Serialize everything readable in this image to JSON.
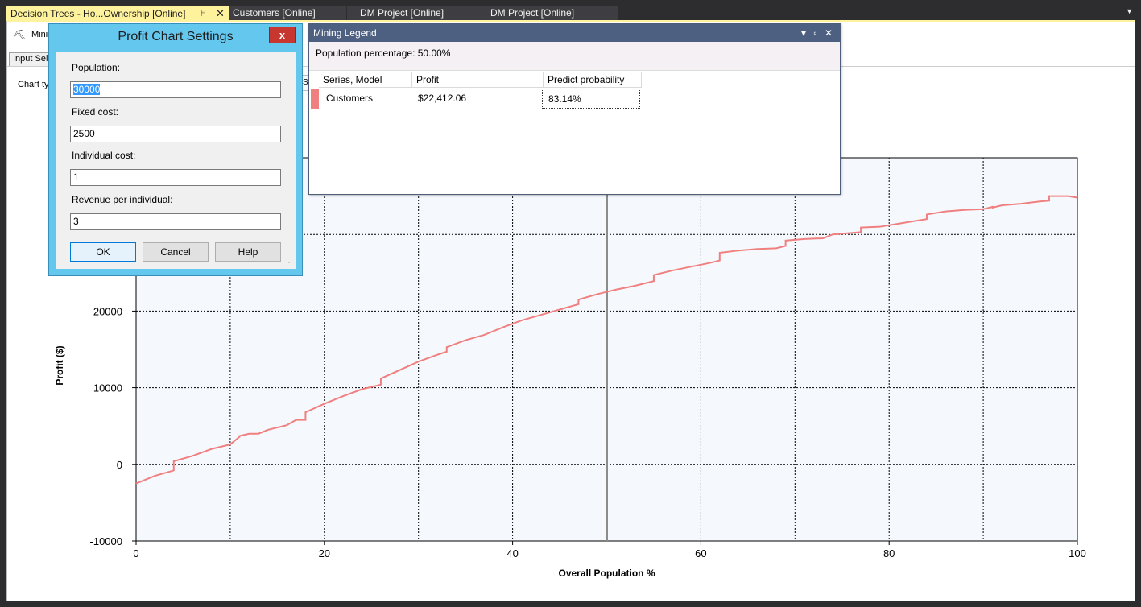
{
  "tabs": [
    {
      "label": "Decision Trees - Ho...Ownership [Online]",
      "active": true
    },
    {
      "label": "Customers [Online]",
      "active": false
    },
    {
      "label": "DM Project [Online]",
      "active": false
    },
    {
      "label": "DM Project [Online]",
      "active": false
    }
  ],
  "tab_pin_glyph": "⊧",
  "tab_close_glyph": "✕",
  "tab_overflow_glyph": "▼",
  "toolbar": {
    "label": "Mini",
    "icon": "pickaxe-icon"
  },
  "subtab_label": "Input Sel",
  "chart_type_label": "Chart ty",
  "chart_type_combo_text": "S",
  "dialog": {
    "title": "Profit Chart Settings",
    "close_glyph": "x",
    "fields": [
      {
        "label": "Population:",
        "value": "30000"
      },
      {
        "label": "Fixed cost:",
        "value": "2500"
      },
      {
        "label": "Individual cost:",
        "value": "1"
      },
      {
        "label": "Revenue per individual:",
        "value": "3"
      }
    ],
    "buttons": {
      "ok": "OK",
      "cancel": "Cancel",
      "help": "Help"
    }
  },
  "legend": {
    "title": "Mining Legend",
    "window_buttons": "▾ ▫ ✕",
    "population_text": "Population percentage: 50.00%",
    "columns": [
      "Series, Model",
      "Profit",
      "Predict probability"
    ],
    "rows": [
      {
        "series": "Customers",
        "profit": "$22,412.06",
        "probability": "83.14%",
        "color": "#f08080"
      }
    ]
  },
  "chart_data": {
    "type": "line",
    "xlabel": "Overall Population %",
    "ylabel": "Profit ($)",
    "xlim": [
      0,
      100
    ],
    "ylim": [
      -10000,
      40000
    ],
    "x_ticks": [
      "0",
      "20",
      "40",
      "60",
      "80",
      "100"
    ],
    "y_ticks": [
      "-10000",
      "0",
      "10000",
      "20000"
    ],
    "series": [
      {
        "color": "#f08080",
        "x": [
          0,
          2,
          4,
          4,
          6,
          8,
          10,
          11,
          11,
          12,
          13,
          14,
          16,
          17,
          18,
          18,
          20,
          22,
          24,
          26,
          26,
          28,
          30,
          32,
          33,
          33,
          35,
          37,
          39,
          41,
          43,
          45,
          47,
          47,
          49,
          51,
          53,
          55,
          55,
          57,
          59,
          61,
          62,
          62,
          64,
          66,
          68,
          69,
          69,
          71,
          73,
          74,
          77,
          77,
          79,
          81,
          84,
          84,
          86,
          88,
          90,
          91,
          91,
          92,
          94,
          96,
          97,
          97,
          99,
          100
        ],
        "y": [
          -2500,
          -1500,
          -800,
          400,
          1100,
          2000,
          2600,
          3600,
          3700,
          4000,
          4000,
          4500,
          5100,
          5800,
          5800,
          6800,
          7900,
          8900,
          9800,
          10400,
          11200,
          12300,
          13400,
          14300,
          14700,
          15300,
          16200,
          16900,
          17900,
          18800,
          19500,
          20200,
          20900,
          21500,
          22200,
          22800,
          23300,
          23900,
          24700,
          25300,
          25800,
          26300,
          26600,
          27600,
          27900,
          28100,
          28200,
          28500,
          29200,
          29400,
          29500,
          30000,
          30300,
          30900,
          31000,
          31400,
          32000,
          32600,
          33000,
          33200,
          33300,
          33600,
          33500,
          33800,
          34000,
          34300,
          34400,
          35000,
          35000,
          34800
        ]
      }
    ],
    "vertical_marker_x": 50,
    "grid": true
  }
}
